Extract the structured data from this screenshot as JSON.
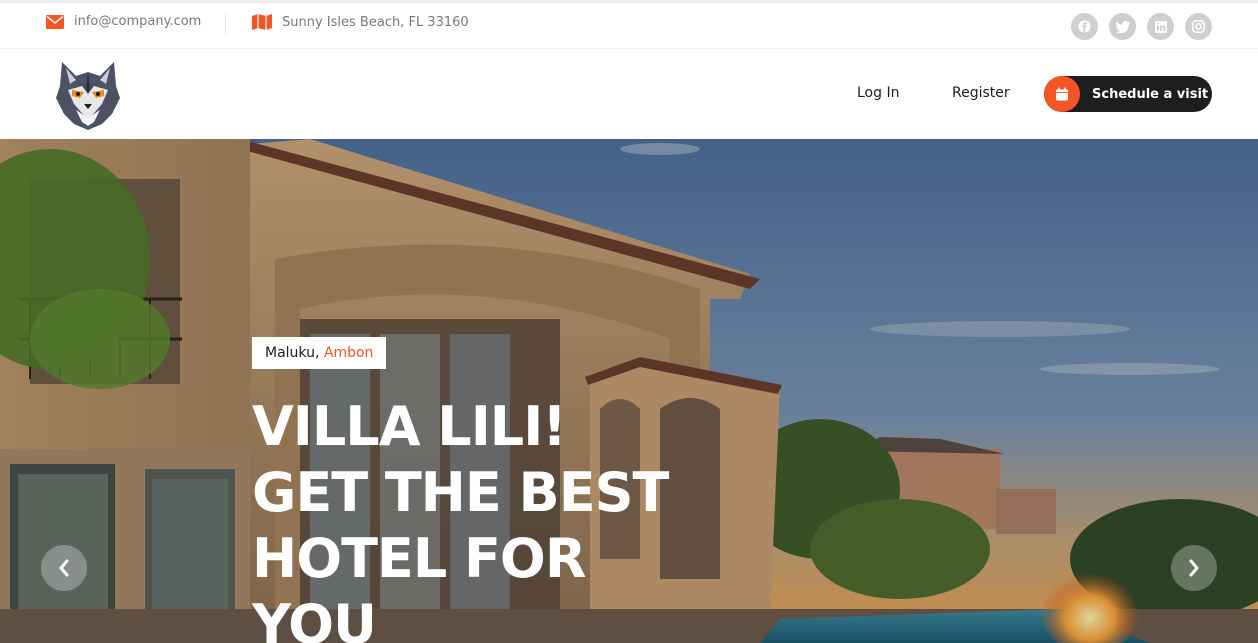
{
  "topbar": {
    "email": "info@company.com",
    "address": "Sunny Isles Beach, FL 33160",
    "email_icon": "envelope-icon",
    "address_icon": "map-icon",
    "socials": [
      "facebook-icon",
      "twitter-icon",
      "linkedin-icon",
      "instagram-icon"
    ]
  },
  "nav": {
    "login": "Log In",
    "register": "Register",
    "schedule": "Schedule a visit",
    "schedule_icon": "calendar-icon"
  },
  "hero": {
    "location_region": "Maluku,",
    "location_city": "Ambon",
    "title_line1": "VILLA LILI!",
    "title_line2": "GET THE BEST",
    "title_line3": "HOTEL FOR",
    "title_line4": "YOU",
    "prev_icon": "chevron-left-icon",
    "next_icon": "chevron-right-icon"
  },
  "colors": {
    "accent": "#f35525",
    "dark": "#1e1e1e",
    "muted_text": "#7a7a7a"
  }
}
